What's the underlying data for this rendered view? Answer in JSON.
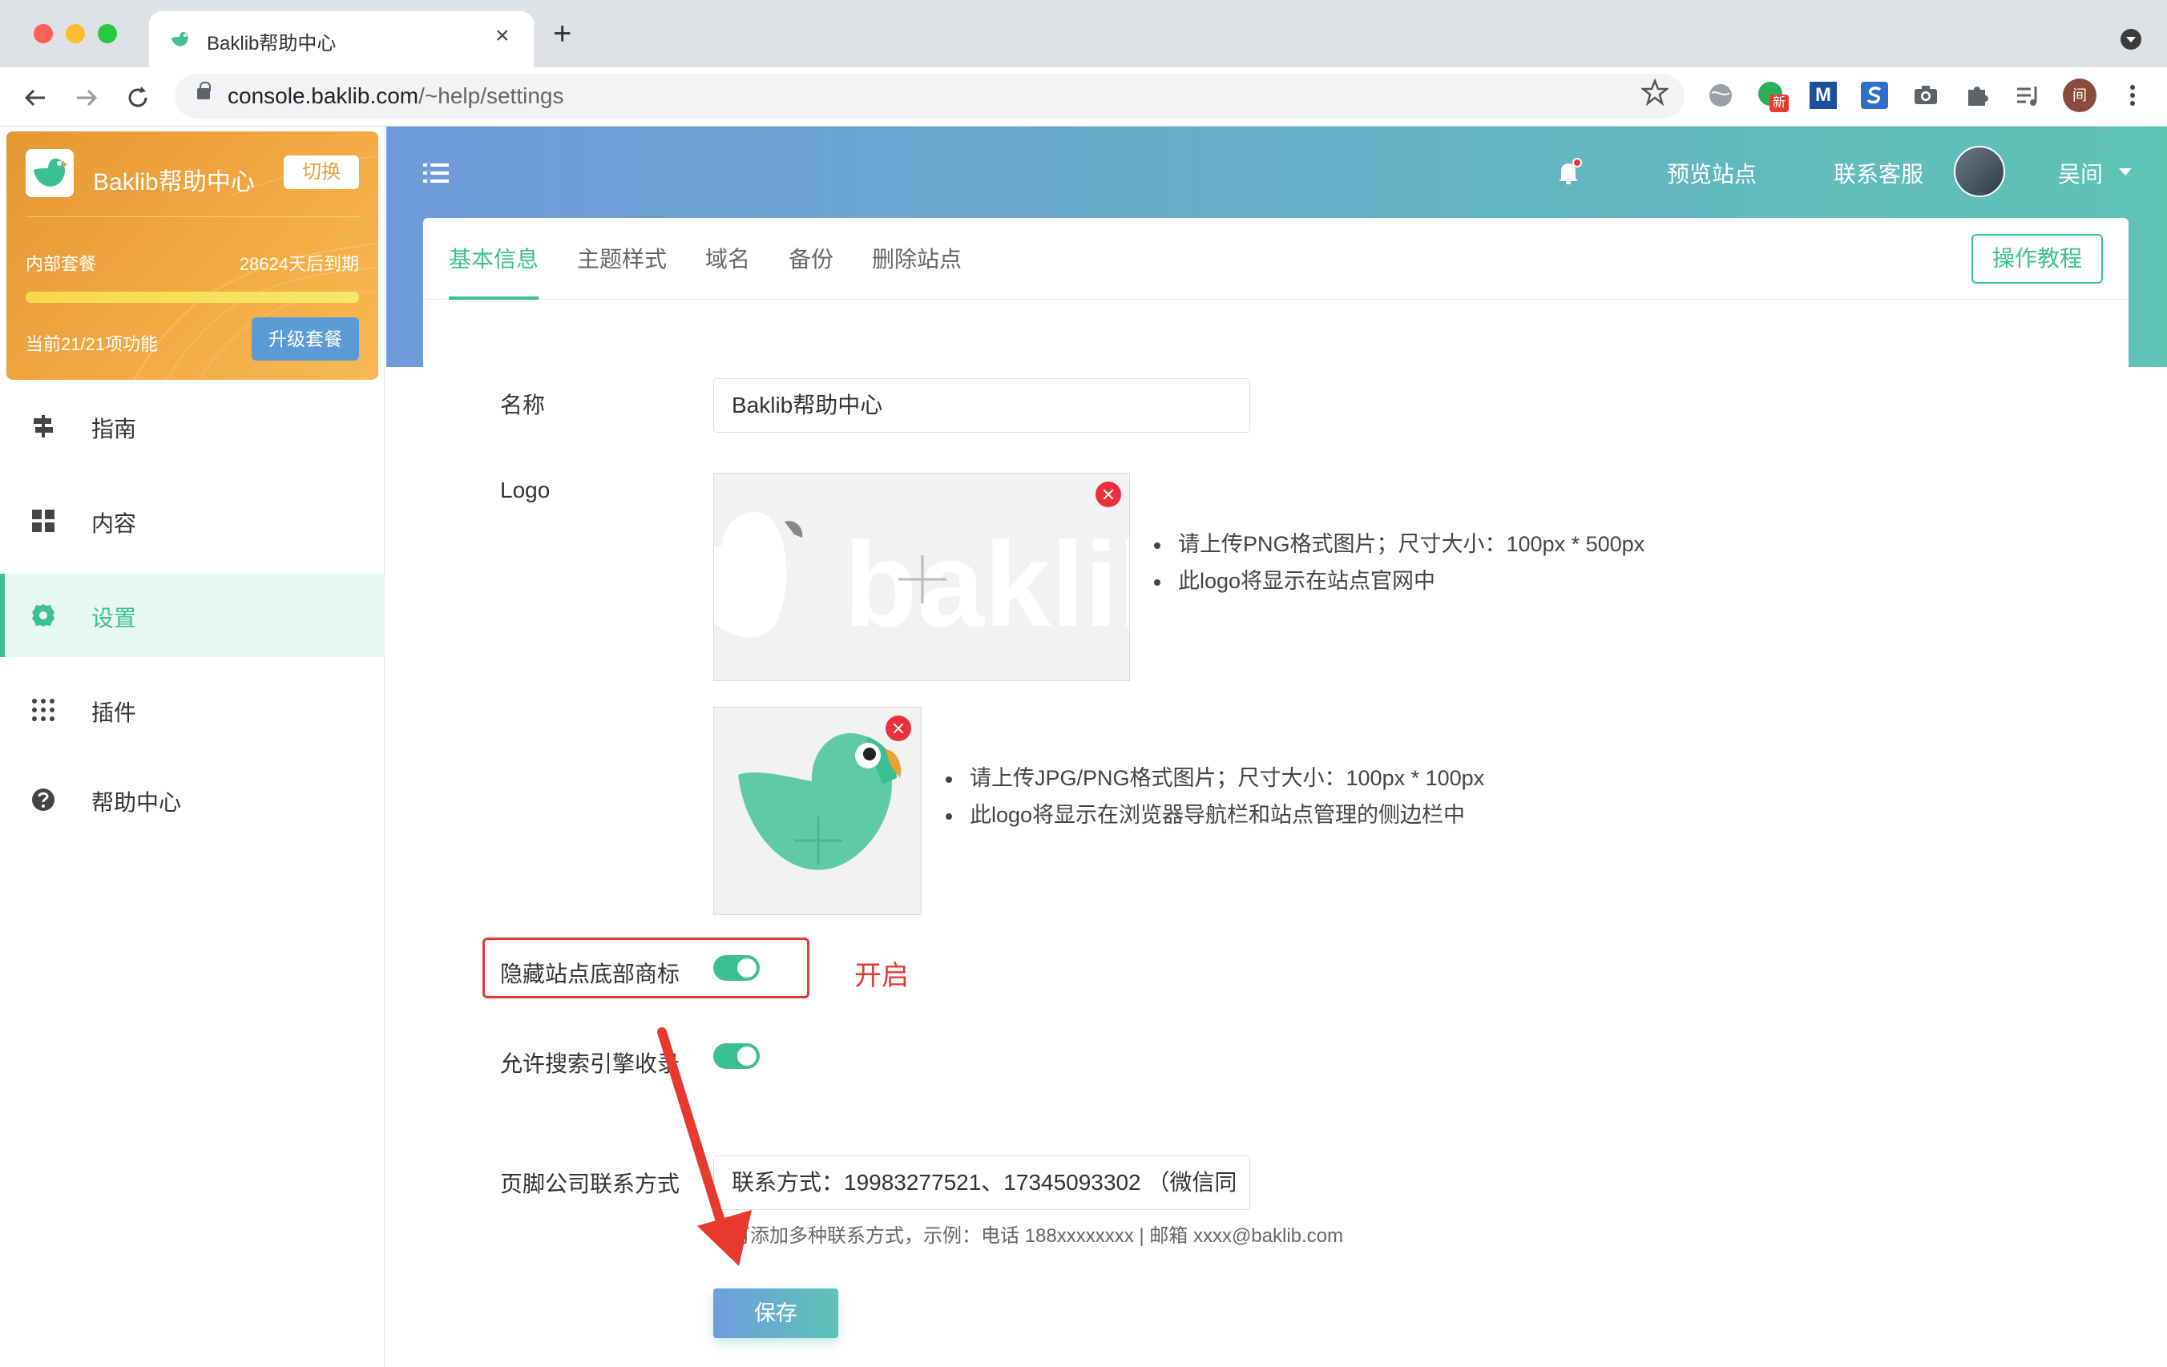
{
  "browser": {
    "tab_title": "Baklib帮助中心",
    "tab_close": "×",
    "new_tab": "+",
    "url_host": "console.baklib.com",
    "url_path": "/~help/settings",
    "traffic_colors": [
      "#fe5f57",
      "#febc2e",
      "#28c840"
    ],
    "extensions": [
      "globe-icon",
      "extension-new-icon",
      "extension-m-icon",
      "extension-s-icon",
      "camera-icon",
      "puzzle-icon",
      "reading-list-icon",
      "profile-avatar",
      "more-menu-icon"
    ],
    "ext_new_badge": "新",
    "ext_m_label": "M",
    "profile_initial": "间"
  },
  "sidebar": {
    "site_name": "Baklib帮助中心",
    "switch_label": "切换",
    "plan_name": "内部套餐",
    "expiry": "28624天后到期",
    "plan_progress": 1.0,
    "features": "当前21/21项功能",
    "upgrade_label": "升级套餐",
    "items": [
      {
        "label": "指南",
        "icon": "signpost-icon"
      },
      {
        "label": "内容",
        "icon": "grid-icon"
      },
      {
        "label": "设置",
        "icon": "gear-icon",
        "active": true
      },
      {
        "label": "插件",
        "icon": "dots-grid-icon"
      },
      {
        "label": "帮助中心",
        "icon": "question-icon"
      }
    ]
  },
  "header": {
    "preview": "预览站点",
    "support": "联系客服",
    "user_name": "吴间"
  },
  "tabs": [
    "基本信息",
    "主题样式",
    "域名",
    "备份",
    "删除站点"
  ],
  "tutorial_label": "操作教程",
  "form": {
    "name_label": "名称",
    "name_value": "Baklib帮助中心",
    "logo_label": "Logo",
    "logo_hint_1": "请上传PNG格式图片；尺寸大小：100px * 500px",
    "logo_hint_2": "此logo将显示在站点官网中",
    "icon_hint_1": "请上传JPG/PNG格式图片；尺寸大小：100px * 100px",
    "icon_hint_2": "此logo将显示在浏览器导航栏和站点管理的侧边栏中",
    "hide_brand_label": "隐藏站点底部商标",
    "hide_brand_on": true,
    "annotation": "开启",
    "seo_label": "允许搜索引擎收录",
    "seo_on": true,
    "footer_label": "页脚公司联系方式",
    "footer_value": "联系方式：19983277521、17345093302 （微信同",
    "footer_help": "可添加多种联系方式，示例：电话 188xxxxxxxx | 邮箱 xxxx@baklib.com",
    "save_label": "保存"
  },
  "colors": {
    "accent": "#3dbf96",
    "annotation_red": "#e8392f",
    "header_gradient_start": "#6f9bdb",
    "header_gradient_end": "#5ec3b3",
    "card_orange": "#f4ab45"
  }
}
